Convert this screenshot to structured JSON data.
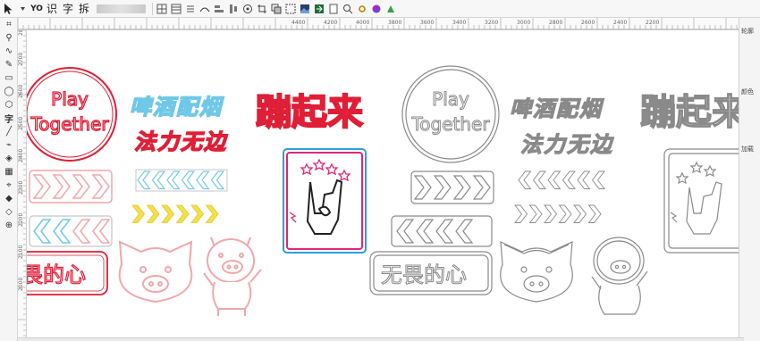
{
  "toolbar": {
    "buttons": [
      "识",
      "字",
      "拆"
    ]
  },
  "ruler": {
    "top_labels": [
      "4400",
      "4200",
      "4000",
      "3800",
      "3600",
      "3400",
      "3200",
      "3000",
      "2800",
      "2600",
      "2400",
      "2200"
    ],
    "left_labels": [
      "2800",
      "2700",
      "2600",
      "2500",
      "2400",
      "2300",
      "2200",
      "2100",
      "2000"
    ]
  },
  "docker": {
    "tabs": [
      "轮廓",
      "颜色",
      "加载"
    ]
  },
  "colors": {
    "red": "#e01e36",
    "pink": "#f2a6ad",
    "cyan": "#6fc8e8",
    "yellow": "#f3e04a",
    "outline": "#8a8a8a",
    "magenta": "#e0267a",
    "blue": "#2aa0d8"
  },
  "artwork": {
    "badge_line1": "Play",
    "badge_line2": "Together",
    "beer_text": "啤酒配烟",
    "fa_text": "法力无边",
    "title_text": "蹦起来",
    "fear_text": "无畏的心",
    "fear_text_partial": "畏的心"
  }
}
